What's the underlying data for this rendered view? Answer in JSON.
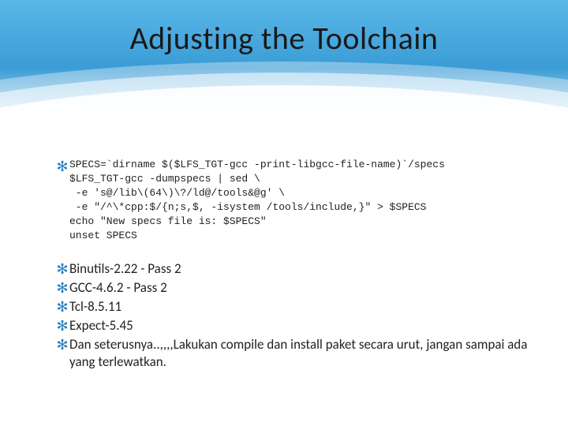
{
  "title": "Adjusting the Toolchain",
  "code": {
    "l1": "SPECS=`dirname $($LFS_TGT-gcc -print-libgcc-file-name)`/specs",
    "l2": "$LFS_TGT-gcc -dumpspecs | sed \\",
    "l3": " -e 's@/lib\\(64\\)\\?/ld@/tools&@g' \\",
    "l4": " -e \"/^\\*cpp:$/{n;s,$, -isystem /tools/include,}\" > $SPECS",
    "l5": "echo \"New specs file is: $SPECS\"",
    "l6": "unset SPECS"
  },
  "bullets": {
    "b1": "Binutils-2.22 - Pass 2",
    "b2": "GCC-4.6.2 - Pass 2",
    "b3": "Tcl-8.5.11",
    "b4": "Expect-5.45",
    "b5": "Dan seterusnya..,,,,Lakukan compile dan install paket secara urut, jangan sampai ada yang terlewatkan."
  }
}
